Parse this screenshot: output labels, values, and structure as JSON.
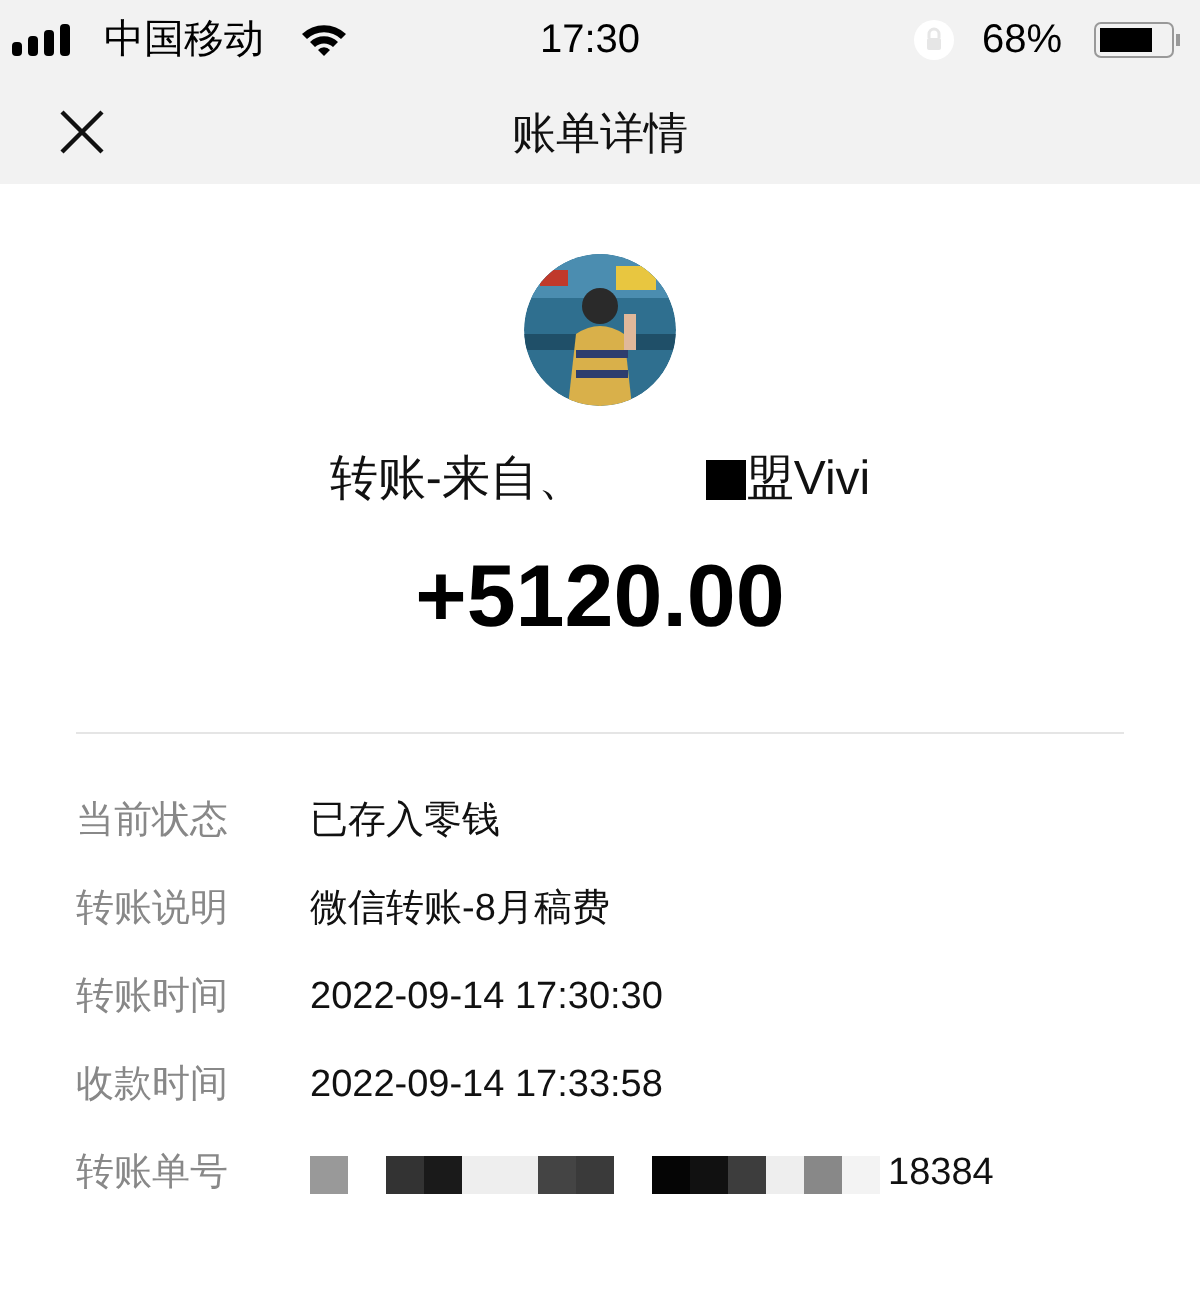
{
  "status_bar": {
    "carrier": "中国移动",
    "time": "17:30",
    "battery": "68%"
  },
  "nav": {
    "title": "账单详情"
  },
  "header": {
    "title_start": "转账-来自、",
    "title_end": "盟Vivi",
    "amount": "+5120.00"
  },
  "details": [
    {
      "label": "当前状态",
      "value": "已存入零钱"
    },
    {
      "label": "转账说明",
      "value": "微信转账-8月稿费"
    },
    {
      "label": "转账时间",
      "value": "2022-09-14 17:30:30"
    },
    {
      "label": "收款时间",
      "value": "2022-09-14 17:33:58"
    },
    {
      "label": "转账单号",
      "value": "18384",
      "kind": "redacted"
    }
  ]
}
